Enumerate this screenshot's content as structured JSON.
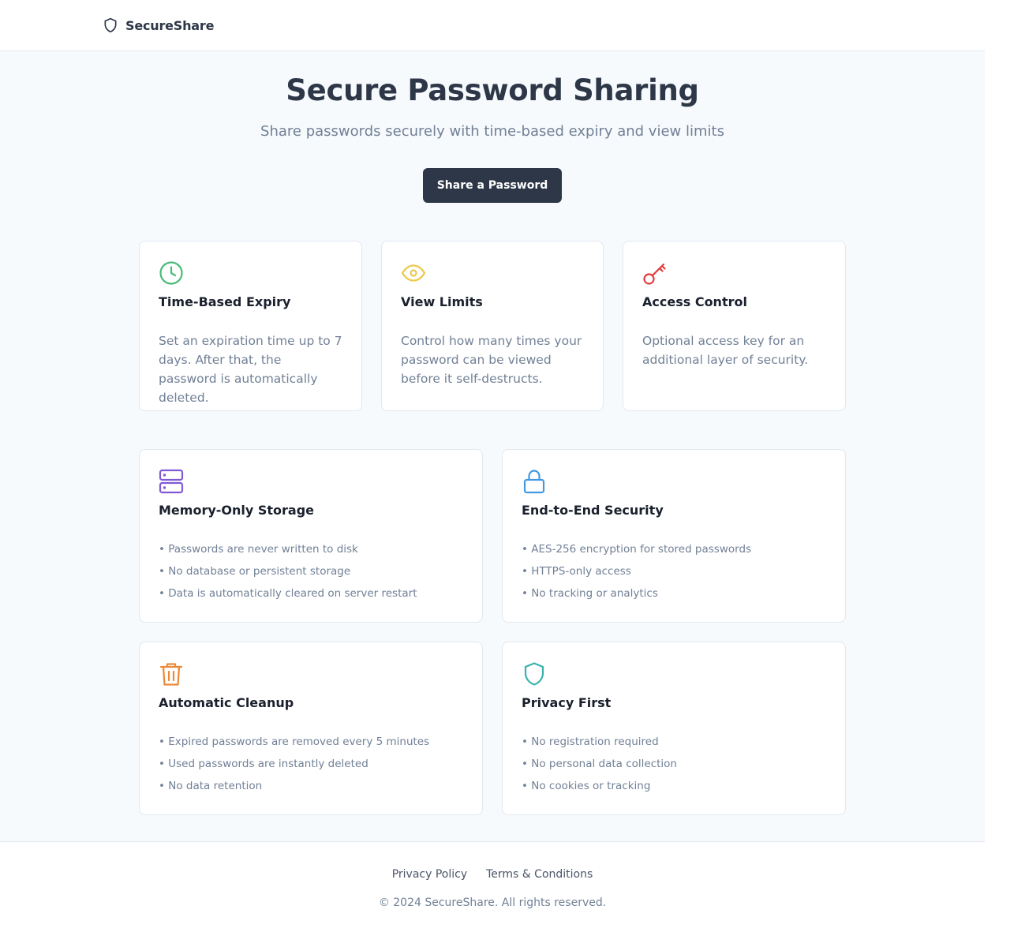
{
  "header": {
    "brand_name": "SecureShare",
    "brand_icon": "shield-icon"
  },
  "hero": {
    "title": "Secure Password Sharing",
    "subtitle": "Share passwords securely with time-based expiry and view limits",
    "cta_label": "Share a Password"
  },
  "features": [
    {
      "icon": "clock-icon",
      "color": "#48bb78",
      "title": "Time-Based Expiry",
      "description": "Set an expiration time up to 7 days. After that, the password is automatically deleted."
    },
    {
      "icon": "eye-icon",
      "color": "#ecc94b",
      "title": "View Limits",
      "description": "Control how many times your password can be viewed before it self-destructs."
    },
    {
      "icon": "key-icon",
      "color": "#e53e3e",
      "title": "Access Control",
      "description": "Optional access key for an additional layer of security."
    }
  ],
  "details": [
    {
      "icon": "server-icon",
      "color": "#805ad5",
      "title": "Memory-Only Storage",
      "items": [
        "Passwords are never written to disk",
        "No database or persistent storage",
        "Data is automatically cleared on server restart"
      ]
    },
    {
      "icon": "lock-icon",
      "color": "#4299e1",
      "title": "End-to-End Security",
      "items": [
        "AES-256 encryption for stored passwords",
        "HTTPS-only access",
        "No tracking or analytics"
      ]
    },
    {
      "icon": "trash-icon",
      "color": "#ed8936",
      "title": "Automatic Cleanup",
      "items": [
        "Expired passwords are removed every 5 minutes",
        "Used passwords are instantly deleted",
        "No data retention"
      ]
    },
    {
      "icon": "shield-icon",
      "color": "#38b2ac",
      "title": "Privacy First",
      "items": [
        "No registration required",
        "No personal data collection",
        "No cookies or tracking"
      ]
    }
  ],
  "footer": {
    "links": [
      "Privacy Policy",
      "Terms & Conditions"
    ],
    "copyright": "© 2024 SecureShare. All rights reserved."
  }
}
